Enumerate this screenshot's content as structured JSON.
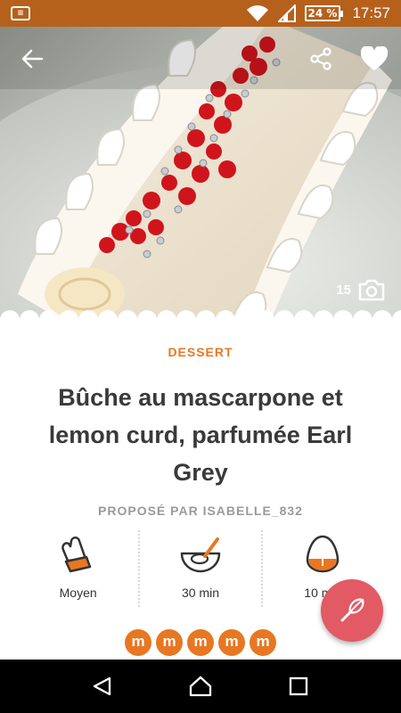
{
  "status_bar": {
    "notification_icon": "message-icon",
    "battery_level": "24 %",
    "time": "17:57"
  },
  "hero": {
    "photo_count": "15",
    "icons": [
      "back-arrow-icon",
      "share-icon",
      "heart-icon",
      "camera-icon"
    ]
  },
  "recipe": {
    "category": "DESSERT",
    "title": "Bûche au mascarpone et lemon curd, parfumée Earl Grey",
    "author": "PROPOSÉ PAR ISABELLE_832"
  },
  "info": {
    "difficulty": "Moyen",
    "prep_time": "30 min",
    "cook_time": "10 min"
  },
  "rating": {
    "badge_letter": "m",
    "count": 5
  },
  "colors": {
    "accent": "#e87722",
    "status_bar": "#b5611c",
    "fab": "#e25a63"
  },
  "navigation": {
    "icons": [
      "back-triangle-icon",
      "home-icon",
      "recents-icon"
    ]
  }
}
